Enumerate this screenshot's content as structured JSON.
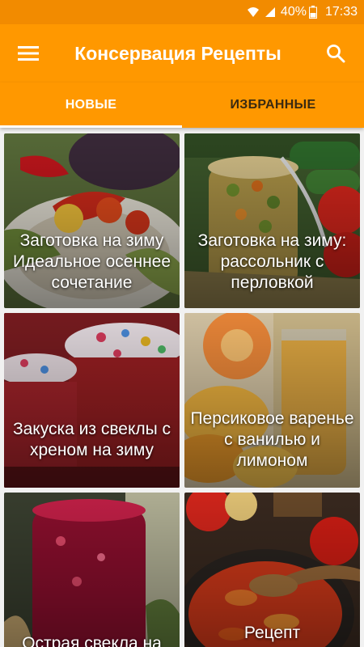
{
  "status_bar": {
    "battery": "40%",
    "time": "17:33",
    "icons": [
      "wifi-icon",
      "signal-icon",
      "battery-icon"
    ]
  },
  "app_bar": {
    "title": "Консервация Рецепты",
    "menu_icon": "hamburger-menu-icon",
    "search_icon": "search-icon"
  },
  "tabs": [
    {
      "label": "НОВЫЕ",
      "active": true
    },
    {
      "label": "ИЗБРАННЫЕ",
      "active": false
    }
  ],
  "recipes": [
    {
      "title": "Заготовка на зиму Идеальное осеннее сочетание"
    },
    {
      "title": "Заготовка на зиму: рассольник с перловкой"
    },
    {
      "title": "Закуска из свеклы с хреном на зиму"
    },
    {
      "title": "Персиковое варенье с ванилью и лимоном"
    },
    {
      "title": "Острая свекла на зиму"
    },
    {
      "title": "Рецепт приготовления лечо"
    }
  ],
  "colors": {
    "status_bar": "#f28b00",
    "app_bar": "#ff9800",
    "tab_active_text": "#ffffff",
    "tab_inactive_text": "#3a2a10"
  }
}
